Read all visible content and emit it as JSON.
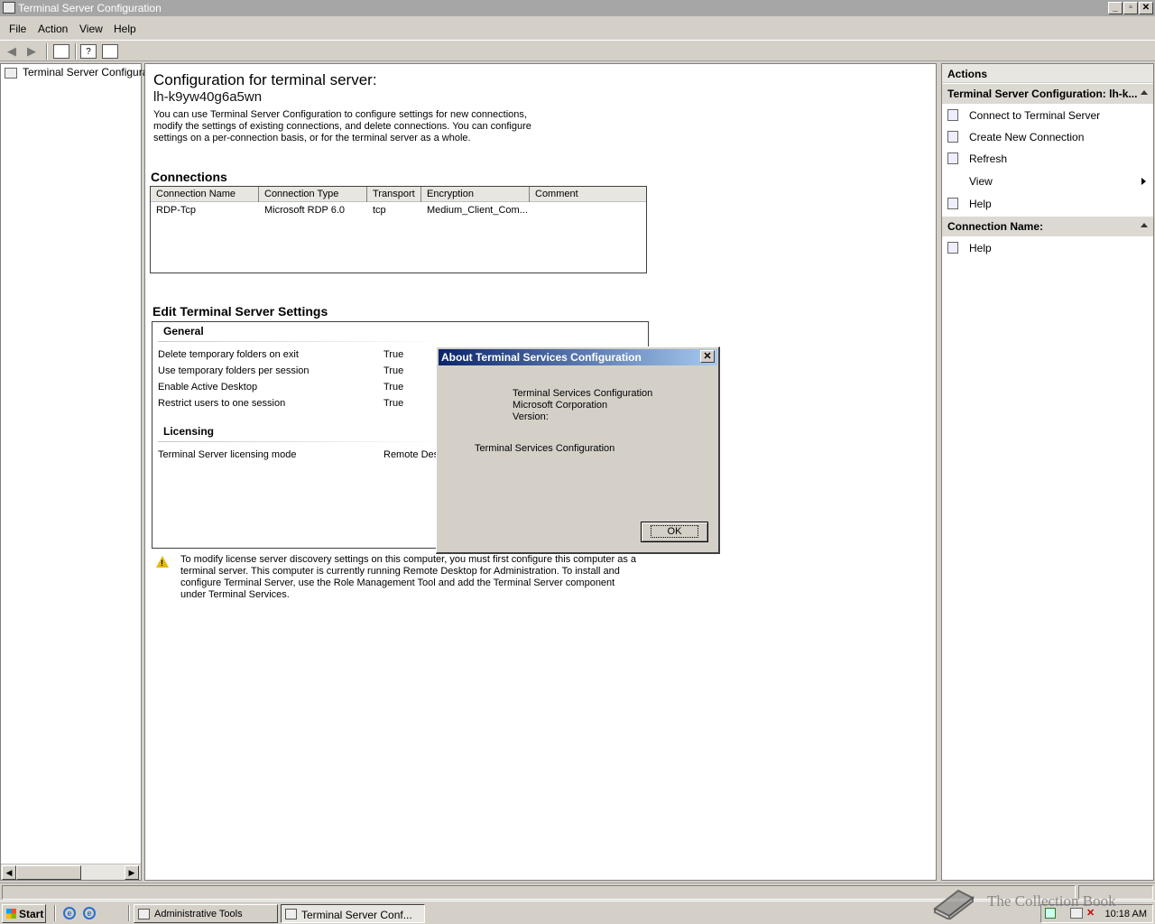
{
  "window": {
    "title": "Terminal Server Configuration"
  },
  "menubar": {
    "items": [
      "File",
      "Action",
      "View",
      "Help"
    ]
  },
  "tree": {
    "item": "Terminal Server Configurati"
  },
  "main": {
    "title": "Configuration for terminal server:",
    "server": "lh-k9yw40g6a5wn",
    "description": "You can use Terminal Server Configuration to configure settings for new connections, modify the settings of existing connections, and delete connections. You can configure settings on a per-connection basis, or for the terminal server as a whole.",
    "connections_heading": "Connections",
    "columns": [
      "Connection Name",
      "Connection Type",
      "Transport",
      "Encryption",
      "Comment"
    ],
    "rows": [
      [
        "RDP-Tcp",
        "Microsoft RDP 6.0",
        "tcp",
        "Medium_Client_Com...",
        ""
      ]
    ],
    "edit_heading": "Edit Terminal Server Settings",
    "general_heading": "General",
    "general": [
      {
        "name": "Delete temporary folders on exit",
        "value": "True"
      },
      {
        "name": "Use temporary folders per session",
        "value": "True"
      },
      {
        "name": "Enable Active Desktop",
        "value": "True"
      },
      {
        "name": "Restrict users to one session",
        "value": "True"
      }
    ],
    "licensing_heading": "Licensing",
    "licensing": [
      {
        "name": "Terminal Server licensing mode",
        "value": "Remote Des"
      }
    ],
    "warning": "To modify license server discovery settings on this computer, you must first configure this computer as a terminal server. This computer is currently running Remote Desktop for Administration. To install and configure Terminal Server, use the Role Management Tool and add the Terminal Server component under Terminal Services."
  },
  "actions": {
    "header": "Actions",
    "section1": "Terminal Server Configuration: lh-k...",
    "items1": [
      "Connect to Terminal Server",
      "Create New Connection",
      "Refresh",
      "View",
      "Help"
    ],
    "section2": "Connection Name:",
    "items2": [
      "Help"
    ]
  },
  "dialog": {
    "title": "About Terminal Services Configuration",
    "line1": "Terminal Services Configuration",
    "line2": "Microsoft Corporation",
    "line3": "Version:",
    "line4": "Terminal Services Configuration",
    "ok": "OK",
    "close": "✕"
  },
  "taskbar": {
    "start": "Start",
    "tasks": [
      "Administrative Tools",
      "Terminal Server Conf..."
    ],
    "clock": "10:18 AM"
  },
  "watermark": "The Collection Book"
}
